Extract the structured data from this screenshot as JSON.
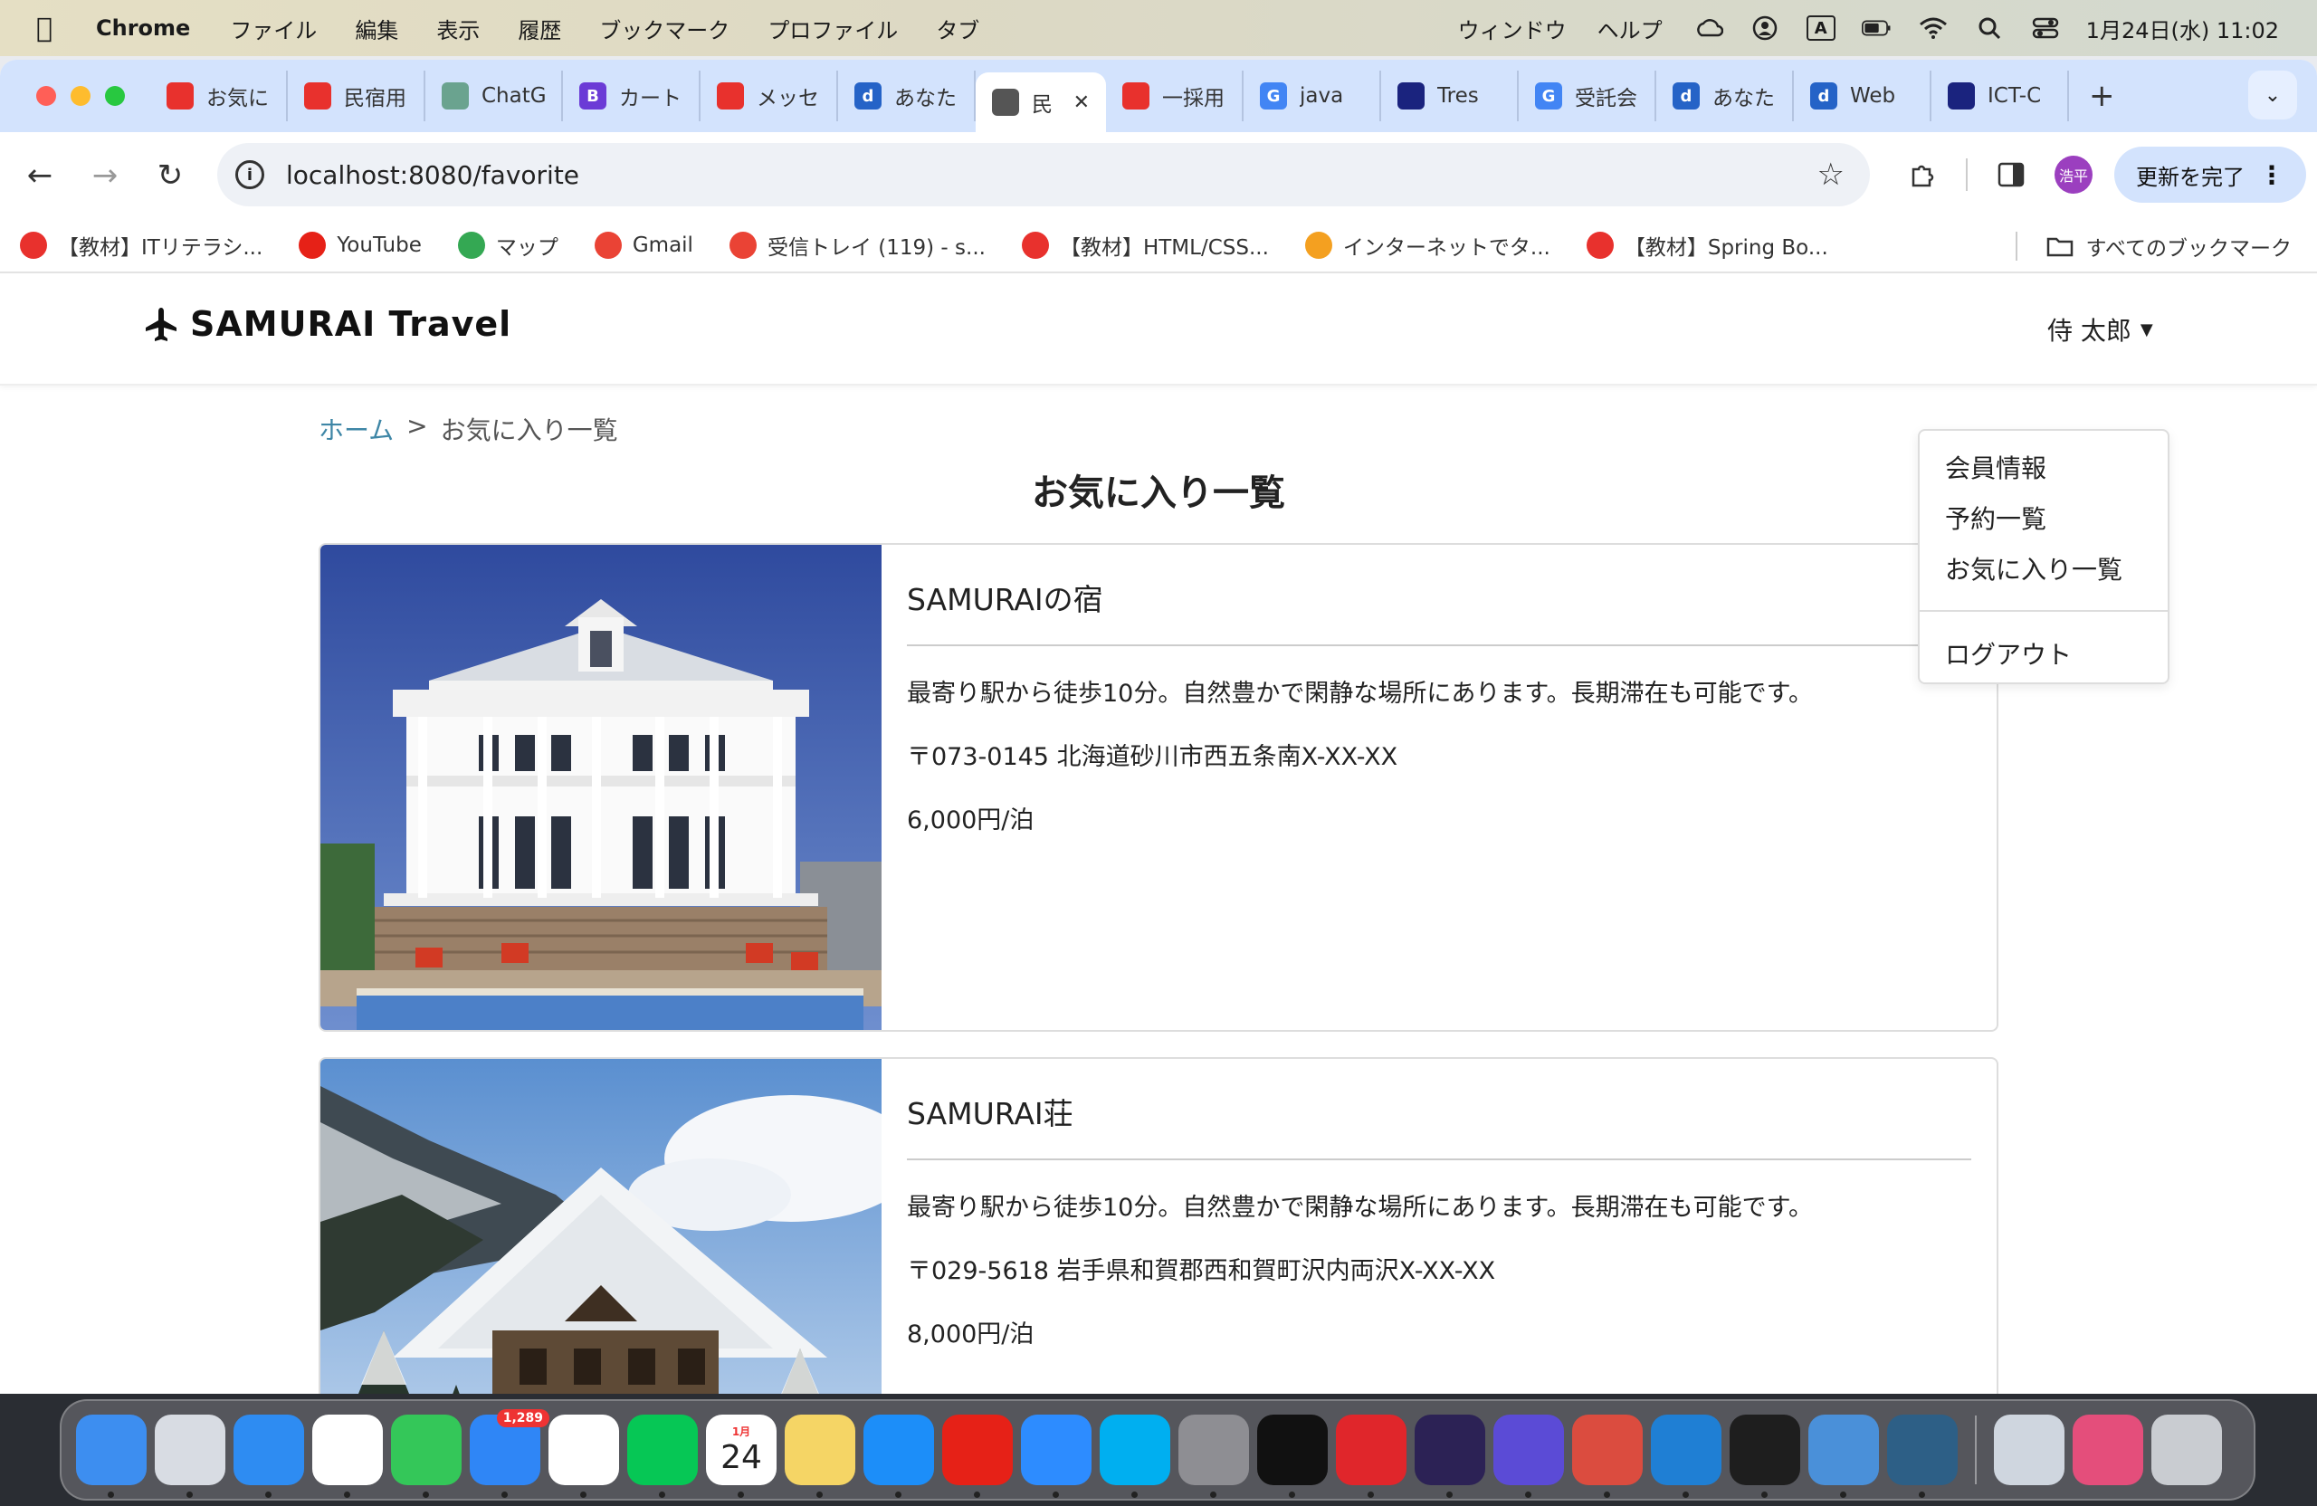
{
  "menubar": {
    "app": "Chrome",
    "items": [
      "ファイル",
      "編集",
      "表示",
      "履歴",
      "ブックマーク",
      "プロファイル",
      "タブ"
    ],
    "right_items": [
      "ウィンドウ",
      "ヘルプ"
    ],
    "input_indicator": "A",
    "clock": "1月24日(水) 11:02"
  },
  "tabs": [
    {
      "title": "お気に",
      "icon_color": "#e8312d"
    },
    {
      "title": "民宿用",
      "icon_color": "#e8312d"
    },
    {
      "title": "ChatG",
      "icon_color": "#6aa38f"
    },
    {
      "title": "カート",
      "icon_color": "#6b3bd6",
      "icon_text": "B"
    },
    {
      "title": "メッセ",
      "icon_color": "#e8312d"
    },
    {
      "title": "あなた",
      "icon_color": "#2563c7",
      "icon_text": "d"
    },
    {
      "title": "民",
      "icon_color": "#555",
      "active": true
    },
    {
      "title": "一採用",
      "icon_color": "#e8312d"
    },
    {
      "title": "java",
      "icon_color": "#4285f4",
      "icon_text": "G"
    },
    {
      "title": "Tres",
      "icon_color": "#1a237e"
    },
    {
      "title": "受託会",
      "icon_color": "#4285f4",
      "icon_text": "G"
    },
    {
      "title": "あなた",
      "icon_color": "#2563c7",
      "icon_text": "d"
    },
    {
      "title": "Web",
      "icon_color": "#2563c7",
      "icon_text": "d"
    },
    {
      "title": "ICT-C",
      "icon_color": "#1a237e"
    }
  ],
  "toolbar": {
    "url": "localhost:8080/favorite",
    "profile_initials": "浩平",
    "update_label": "更新を完了"
  },
  "bookmarks": [
    {
      "label": "【教材】ITリテラシ...",
      "color": "#e8312d"
    },
    {
      "label": "YouTube",
      "color": "#e62117"
    },
    {
      "label": "マップ",
      "color": "#34a853"
    },
    {
      "label": "Gmail",
      "color": "#ea4335"
    },
    {
      "label": "受信トレイ (119) - s...",
      "color": "#ea4335"
    },
    {
      "label": "【教材】HTML/CSS...",
      "color": "#e8312d"
    },
    {
      "label": "インターネットでタ...",
      "color": "#f4a020"
    },
    {
      "label": "【教材】Spring Bo...",
      "color": "#e8312d"
    }
  ],
  "bookmarks_all": "すべてのブックマーク",
  "site": {
    "logo": "SAMURAI Travel",
    "user_name": "侍 太郎",
    "dropdown": [
      "会員情報",
      "予約一覧",
      "お気に入り一覧"
    ],
    "logout": "ログアウト",
    "breadcrumb_home": "ホーム",
    "breadcrumb_sep": ">",
    "breadcrumb_current": "お気に入り一覧",
    "title": "お気に入り一覧"
  },
  "favorites": [
    {
      "name": "SAMURAIの宿",
      "description": "最寄り駅から徒歩10分。自然豊かで閑静な場所にあります。長期滞在も可能です。",
      "address": "〒073-0145 北海道砂川市西五条南X-XX-XX",
      "price": "6,000円/泊"
    },
    {
      "name": "SAMURAI荘",
      "description": "最寄り駅から徒歩10分。自然豊かで閑静な場所にあります。長期滞在も可能です。",
      "address": "〒029-5618 岩手県和賀郡西和賀町沢内両沢X-XX-XX",
      "price": "8,000円/泊"
    }
  ],
  "dock": {
    "mail_badge": "1,289",
    "calendar_month": "1月",
    "calendar_day": "24",
    "apps": [
      "Finder",
      "Launchpad",
      "Safari",
      "Chrome",
      "Messages",
      "Mail",
      "Photos",
      "LINE",
      "Calendar",
      "Notes",
      "App Store",
      "YouTube",
      "Zoom",
      "Skype",
      "System Settings",
      "GitHub",
      "Acrobat",
      "Eclipse",
      "Dbeaver",
      "Todoist",
      "VS Code",
      "Terminal",
      "TablePlus",
      "MySQL Workbench",
      "Preview",
      "Creative Cloud",
      "Trash"
    ]
  }
}
